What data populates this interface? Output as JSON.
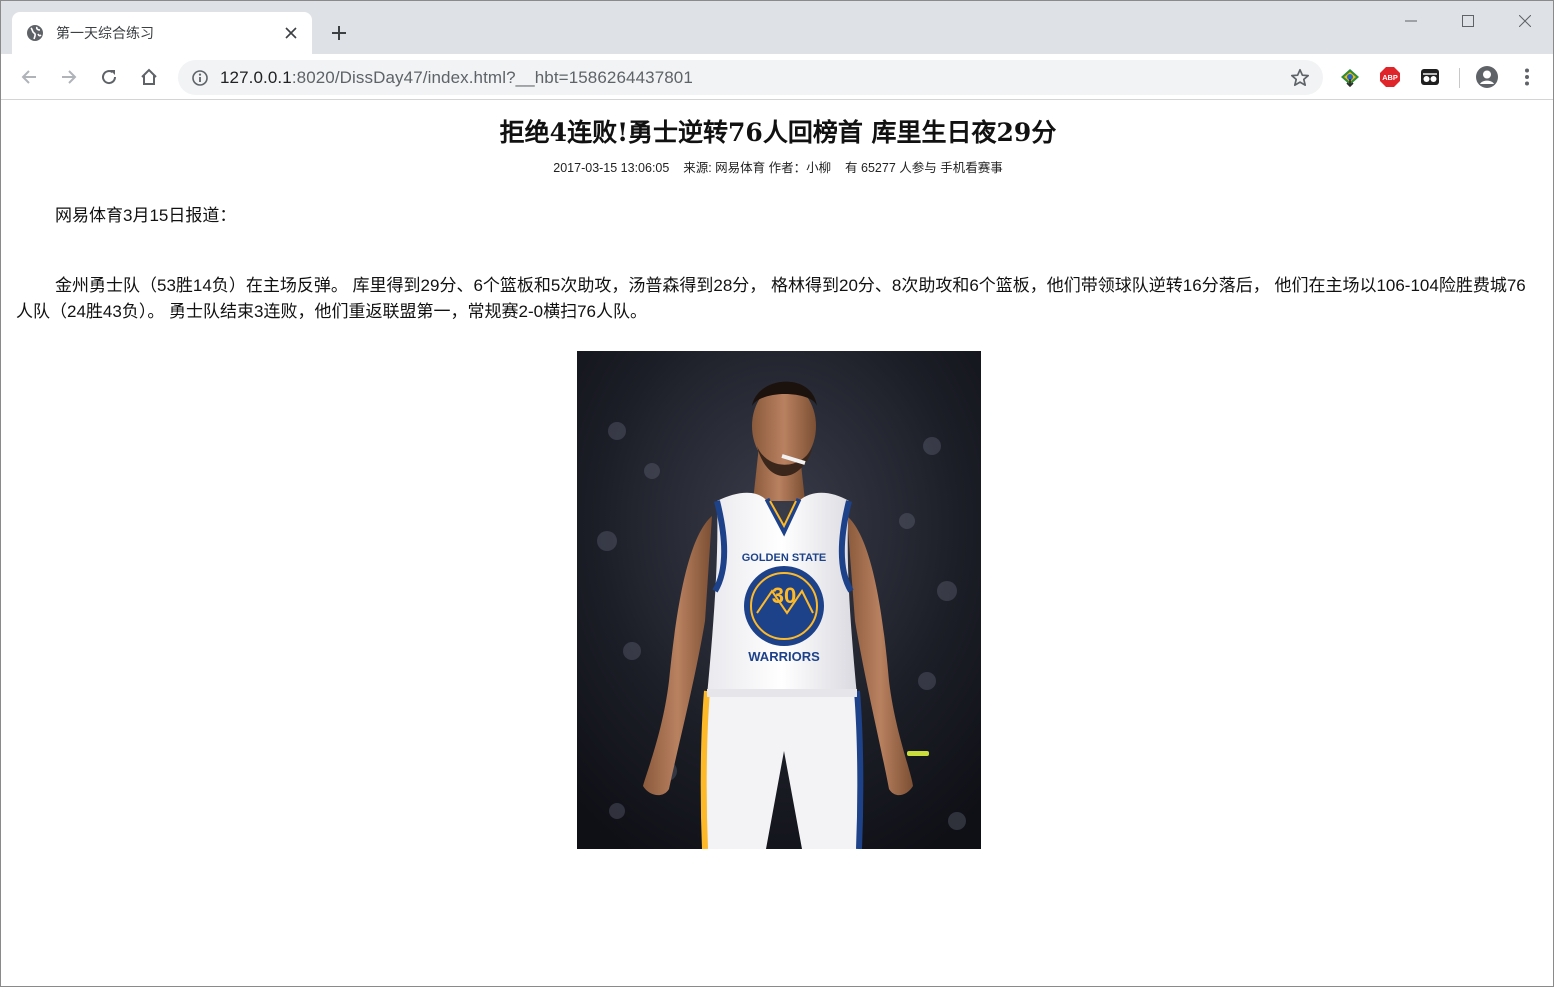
{
  "browser": {
    "tab": {
      "title": "第一天综合练习",
      "favicon": "globe-icon",
      "close": "×"
    },
    "new_tab": "+",
    "address": {
      "host": "127.0.0.1",
      "rest": ":8020/DissDay47/index.html?__hbt=1586264437801"
    },
    "extensions": [
      "idm-icon",
      "adblock-plus-icon",
      "incognito-extension-icon"
    ],
    "ext_labels": {
      "abp": "ABP"
    }
  },
  "article": {
    "title": "拒绝4连败!勇士逆转76人回榜首  库里生日夜29分",
    "meta": "2017-03-15 13:06:05    来源: 网易体育 作者：小柳    有 65277 人参与 手机看赛事",
    "paragraphs": [
      "网易体育3月15日报道：",
      "金州勇士队（53胜14负）在主场反弹。 库里得到29分、6个篮板和5次助攻，汤普森得到28分， 格林得到20分、8次助攻和6个篮板，他们带领球队逆转16分落后， 他们在主场以106-104险胜费城76人队（24胜43负）。 勇士队结束3连败，他们重返联盟第一，常规赛2-0横扫76人队。"
    ],
    "image": {
      "subject": "basketball-player-photo",
      "jersey_text": "GOLDEN STATE",
      "jersey_number": "30",
      "jersey_bottom": "WARRIORS"
    }
  }
}
